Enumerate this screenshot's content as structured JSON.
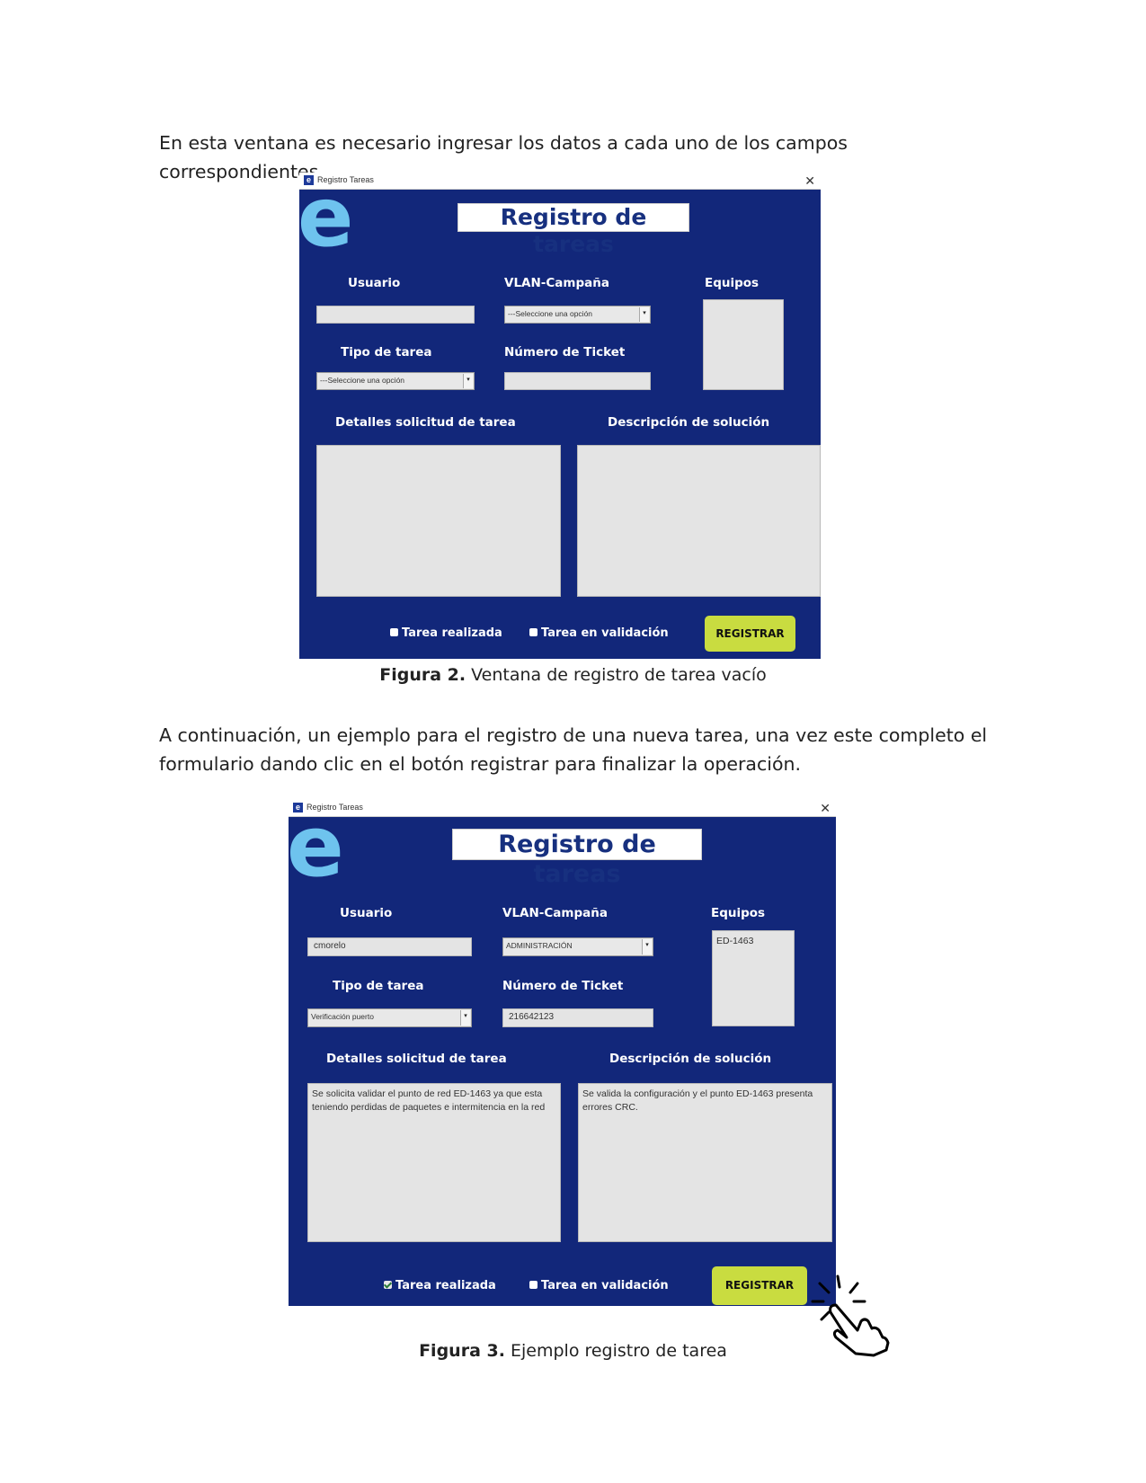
{
  "intro_text": "En esta ventana es necesario ingresar los datos a cada uno de los campos correspondientes.",
  "mid_text": "A continuación, un ejemplo para el registro de una nueva tarea, una vez este completo el formulario dando clic en el botón registrar para finalizar la operación.",
  "figure2": {
    "caption_label": "Figura 2.",
    "caption_text": " Ventana de registro de tarea vacío",
    "window": {
      "title": "Registro Tareas",
      "heading": "Registro de tareas",
      "labels": {
        "usuario": "Usuario",
        "vlan": "VLAN-Campaña",
        "equipos": "Equipos",
        "tipo": "Tipo de tarea",
        "ticket": "Número de Ticket",
        "detalles": "Detalles solicitud de tarea",
        "descripcion": "Descripción de solución"
      },
      "values": {
        "usuario": "",
        "vlan": "---Seleccione una opción",
        "tipo": "---Seleccione una opción",
        "ticket": "",
        "equipos": "",
        "detalles": "",
        "descripcion": ""
      },
      "checkboxes": {
        "realizada": {
          "label": "Tarea realizada",
          "checked": false
        },
        "validacion": {
          "label": "Tarea en validación",
          "checked": false
        }
      },
      "button": "REGISTRAR"
    }
  },
  "figure3": {
    "caption_label": "Figura 3.",
    "caption_text": " Ejemplo registro de tarea",
    "window": {
      "title": "Registro Tareas",
      "heading": "Registro de tareas",
      "labels": {
        "usuario": "Usuario",
        "vlan": "VLAN-Campaña",
        "equipos": "Equipos",
        "tipo": "Tipo de tarea",
        "ticket": "Número de Ticket",
        "detalles": "Detalles solicitud de tarea",
        "descripcion": "Descripción de solución"
      },
      "values": {
        "usuario": "cmorelo",
        "vlan": "ADMINISTRACIÓN",
        "tipo": "Verificación puerto",
        "ticket": "216642123",
        "equipos": "ED-1463",
        "detalles": "Se solicita validar el punto de red ED-1463 ya que esta teniendo perdidas de paquetes e intermitencia en la red",
        "descripcion": "Se valida la configuración y el punto ED-1463 presenta errores CRC."
      },
      "checkboxes": {
        "realizada": {
          "label": "Tarea realizada",
          "checked": true
        },
        "validacion": {
          "label": "Tarea en validación",
          "checked": false
        }
      },
      "button": "REGISTRAR"
    }
  },
  "colors": {
    "window_bg": "#12277a",
    "button": "#c9dc40",
    "logo": "#6ec3ee"
  },
  "icons": [
    "close-icon",
    "app-icon",
    "select-arrow-icon",
    "checkbox-icon",
    "hand-click-icon"
  ]
}
